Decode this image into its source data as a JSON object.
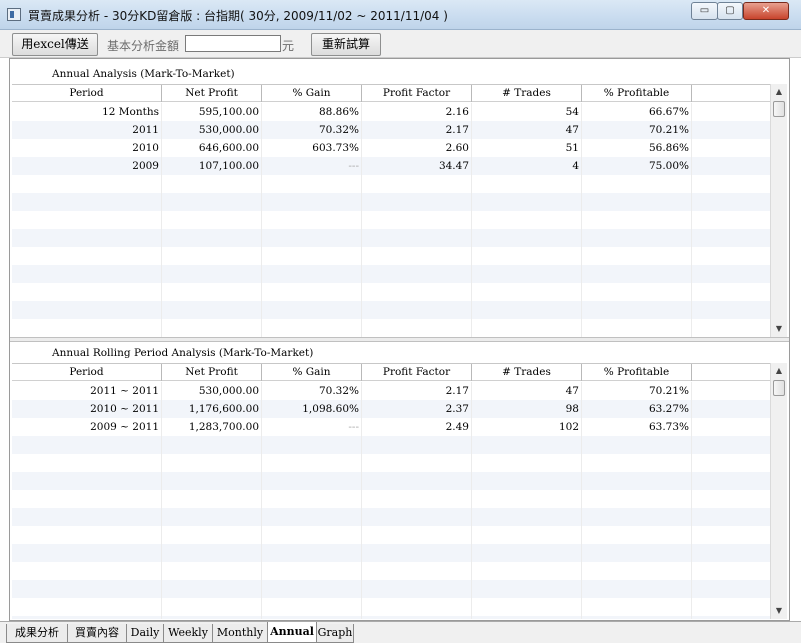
{
  "window": {
    "title": "買賣成果分析 - 30分KD留倉版 : 台指期( 30分, 2009/11/02 ~ 2011/11/04 )",
    "min_symbol": "▭",
    "max_symbol": "▢",
    "close_symbol": "✕"
  },
  "toolbar": {
    "excel_label": "用excel傳送",
    "amount_label": "基本分析金額",
    "amount_value": "",
    "unit_label": "元",
    "recalc_label": "重新試算"
  },
  "columns": [
    "Period",
    "Net Profit",
    "% Gain",
    "Profit Factor",
    "# Trades",
    "% Profitable"
  ],
  "annual": {
    "title": "Annual Analysis (Mark-To-Market)",
    "rows": [
      {
        "period": "12 Months",
        "net_profit": "595,100.00",
        "gain": "88.86%",
        "profit_factor": "2.16",
        "trades": "54",
        "profitable": "66.67%"
      },
      {
        "period": "2011",
        "net_profit": "530,000.00",
        "gain": "70.32%",
        "profit_factor": "2.17",
        "trades": "47",
        "profitable": "70.21%"
      },
      {
        "period": "2010",
        "net_profit": "646,600.00",
        "gain": "603.73%",
        "profit_factor": "2.60",
        "trades": "51",
        "profitable": "56.86%"
      },
      {
        "period": "2009",
        "net_profit": "107,100.00",
        "gain": "---",
        "profit_factor": "34.47",
        "trades": "4",
        "profitable": "75.00%"
      }
    ]
  },
  "rolling": {
    "title": "Annual Rolling Period Analysis (Mark-To-Market)",
    "rows": [
      {
        "period": "2011 ~ 2011",
        "net_profit": "530,000.00",
        "gain": "70.32%",
        "profit_factor": "2.17",
        "trades": "47",
        "profitable": "70.21%"
      },
      {
        "period": "2010 ~ 2011",
        "net_profit": "1,176,600.00",
        "gain": "1,098.60%",
        "profit_factor": "2.37",
        "trades": "98",
        "profitable": "63.27%"
      },
      {
        "period": "2009 ~ 2011",
        "net_profit": "1,283,700.00",
        "gain": "---",
        "profit_factor": "2.49",
        "trades": "102",
        "profitable": "63.73%"
      }
    ]
  },
  "scroll": {
    "up": "▲",
    "down": "▼"
  },
  "tabs": [
    {
      "label": "成果分析",
      "active": false
    },
    {
      "label": "買賣內容",
      "active": false
    },
    {
      "label": "Daily",
      "active": false
    },
    {
      "label": "Weekly",
      "active": false
    },
    {
      "label": "Monthly",
      "active": false
    },
    {
      "label": "Annual",
      "active": true
    },
    {
      "label": "Graph",
      "active": false
    }
  ]
}
